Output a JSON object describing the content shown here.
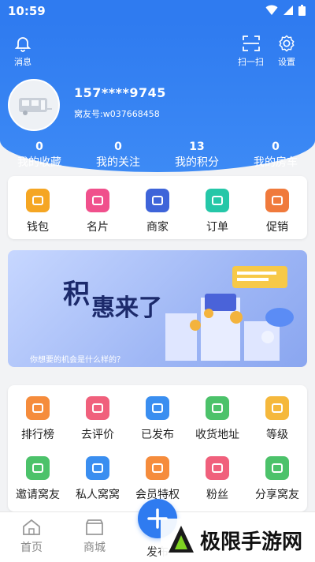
{
  "status_bar": {
    "time": "10:59"
  },
  "header": {
    "messages_label": "消息",
    "scan_label": "扫一扫",
    "settings_label": "设置",
    "phone": "157****9745",
    "user_id": "窝友号:w037668458"
  },
  "stats": [
    {
      "value": "0",
      "label": "我的收藏"
    },
    {
      "value": "0",
      "label": "我的关注"
    },
    {
      "value": "13",
      "label": "我的积分"
    },
    {
      "value": "0",
      "label": "我的房车"
    }
  ],
  "quick_actions": [
    {
      "label": "钱包",
      "icon": "wallet-icon",
      "color": "#f5a623"
    },
    {
      "label": "名片",
      "icon": "card-icon",
      "color": "#f0508c"
    },
    {
      "label": "商家",
      "icon": "shop-icon",
      "color": "#3e64d9"
    },
    {
      "label": "订单",
      "icon": "order-icon",
      "color": "#25c7a8"
    },
    {
      "label": "促销",
      "icon": "promo-icon",
      "color": "#f07a3c"
    }
  ],
  "banner": {
    "title_a": "积",
    "title_b": "惠来了",
    "caption": "你想要的机会是什么样的？"
  },
  "services": [
    {
      "label": "排行榜",
      "icon": "rank-icon",
      "color": "#f58c3c"
    },
    {
      "label": "去评价",
      "icon": "review-icon",
      "color": "#f0607c"
    },
    {
      "label": "已发布",
      "icon": "published-icon",
      "color": "#3a8ef0"
    },
    {
      "label": "收货地址",
      "icon": "address-icon",
      "color": "#4cc26a"
    },
    {
      "label": "等级",
      "icon": "level-icon",
      "color": "#f5b83c"
    },
    {
      "label": "邀请窝友",
      "icon": "invite-icon",
      "color": "#4cc26a"
    },
    {
      "label": "私人窝窝",
      "icon": "private-icon",
      "color": "#3a8ef0"
    },
    {
      "label": "会员特权",
      "icon": "vip-icon",
      "color": "#f58c3c"
    },
    {
      "label": "粉丝",
      "icon": "fans-icon",
      "color": "#f0607c"
    },
    {
      "label": "分享窝友",
      "icon": "share-icon",
      "color": "#4cc26a"
    }
  ],
  "tabbar": {
    "home": "首页",
    "mall": "商城",
    "publish": "发布"
  },
  "watermark": {
    "text": "极限手游网"
  }
}
